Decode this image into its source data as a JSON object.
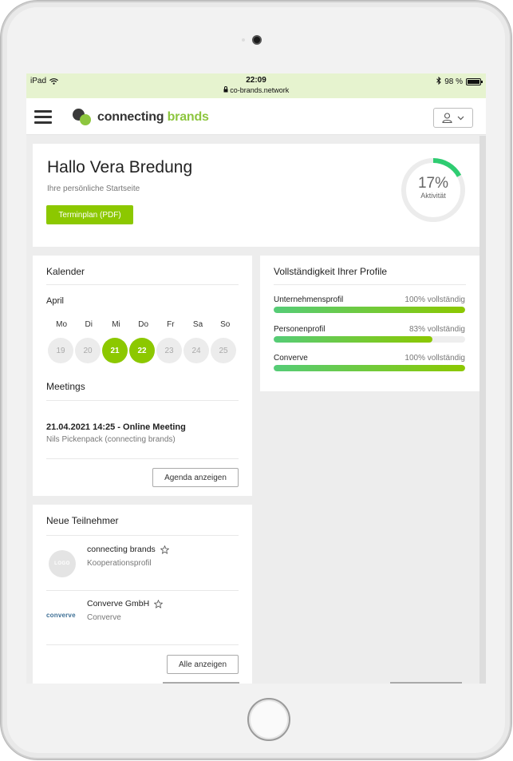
{
  "status_bar": {
    "device": "iPad",
    "time": "22:09",
    "url": "co-brands.network",
    "battery": "98 %",
    "battery_level": 0.98
  },
  "navbar": {
    "brand_part1": "connecting",
    "brand_part2": "brands"
  },
  "welcome": {
    "title": "Hallo Vera Bredung",
    "subtitle": "Ihre persönliche Startseite",
    "button": "Terminplan (PDF)",
    "activity_percent": 17,
    "activity_value": "17%",
    "activity_label": "Aktivität"
  },
  "calendar": {
    "title": "Kalender",
    "month": "April",
    "weekdays": [
      "Mo",
      "Di",
      "Mi",
      "Do",
      "Fr",
      "Sa",
      "So"
    ],
    "days": [
      {
        "label": "19",
        "active": false
      },
      {
        "label": "20",
        "active": false
      },
      {
        "label": "21",
        "active": true
      },
      {
        "label": "22",
        "active": true
      },
      {
        "label": "23",
        "active": false
      },
      {
        "label": "24",
        "active": false
      },
      {
        "label": "25",
        "active": false
      }
    ],
    "meetings_title": "Meetings",
    "meeting": {
      "title": "21.04.2021 14:25 - Online Meeting",
      "participants": "Nils Pickenpack (connecting brands)"
    },
    "agenda_button": "Agenda anzeigen"
  },
  "new_participants": {
    "title": "Neue Teilnehmer",
    "items": [
      {
        "name": "connecting brands",
        "subtitle": "Kooperationsprofil",
        "logo_text": "LOGO"
      },
      {
        "name": "Converve GmbH",
        "subtitle": "Converve",
        "logo_text": "converve"
      }
    ],
    "show_all_button": "Alle anzeigen"
  },
  "profile_completeness": {
    "title": "Vollständigkeit Ihrer Profile",
    "rows": [
      {
        "label": "Unternehmensprofil",
        "status": "100% vollständig",
        "percent": 100
      },
      {
        "label": "Personenprofil",
        "status": "83% vollständig",
        "percent": 83
      },
      {
        "label": "Converve",
        "status": "100% vollständig",
        "percent": 100
      }
    ]
  },
  "colors": {
    "accent_green": "#8cc800",
    "brand_green": "#8dc63f",
    "progress_start": "#55cc77",
    "statusbar_bg": "#e6f3cf"
  }
}
